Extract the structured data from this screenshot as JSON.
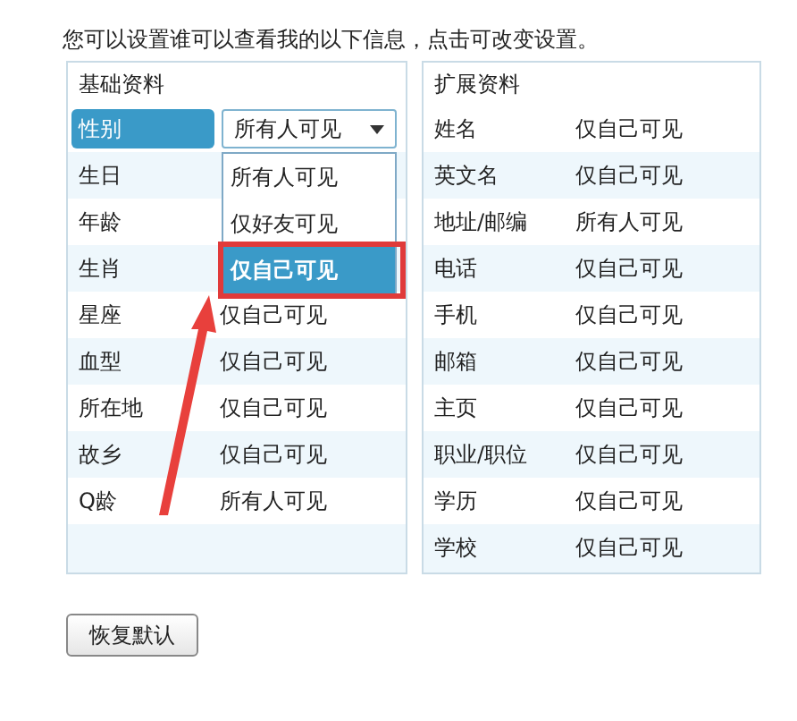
{
  "intro": "您可以设置谁可以查看我的以下信息，点击可改变设置。",
  "basic": {
    "title": "基础资料",
    "rows": [
      {
        "label": "性别",
        "value": "所有人可见",
        "selected": true
      },
      {
        "label": "生日",
        "selected": false
      },
      {
        "label": "年龄",
        "selected": false
      },
      {
        "label": "生肖",
        "selected": false
      },
      {
        "label": "星座",
        "value": "仅自己可见",
        "selected": false
      },
      {
        "label": "血型",
        "value": "仅自己可见",
        "selected": false
      },
      {
        "label": "所在地",
        "value": "仅自己可见",
        "selected": false
      },
      {
        "label": "故乡",
        "value": "仅自己可见",
        "selected": false
      },
      {
        "label": "Q龄",
        "value": "所有人可见",
        "selected": false
      }
    ]
  },
  "dropdown": {
    "options": [
      {
        "label": "所有人可见",
        "selected": false
      },
      {
        "label": "仅好友可见",
        "selected": false
      },
      {
        "label": "仅自己可见",
        "selected": true
      }
    ]
  },
  "extended": {
    "title": "扩展资料",
    "rows": [
      {
        "label": "姓名",
        "value": "仅自己可见"
      },
      {
        "label": "英文名",
        "value": "仅自己可见"
      },
      {
        "label": "地址/邮编",
        "value": "所有人可见"
      },
      {
        "label": "电话",
        "value": "仅自己可见"
      },
      {
        "label": "手机",
        "value": "仅自己可见"
      },
      {
        "label": "邮箱",
        "value": "仅自己可见"
      },
      {
        "label": "主页",
        "value": "仅自己可见"
      },
      {
        "label": "职业/职位",
        "value": "仅自己可见"
      },
      {
        "label": "学历",
        "value": "仅自己可见"
      },
      {
        "label": "学校",
        "value": "仅自己可见"
      }
    ]
  },
  "button": "恢复默认"
}
